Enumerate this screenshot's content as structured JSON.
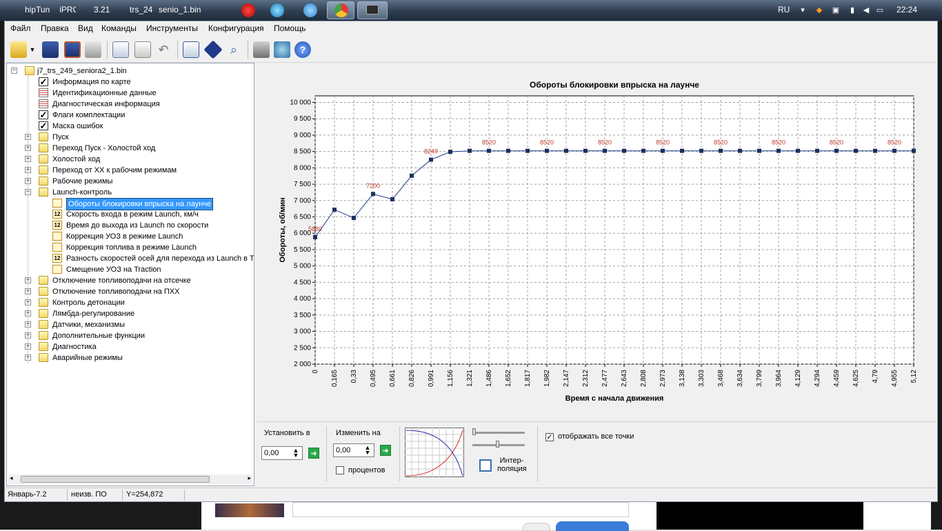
{
  "taskbar": {
    "buttons": [
      "hipTun",
      "iPRO",
      "3.21",
      "trs_24",
      "senio",
      "_1.bin"
    ],
    "lang": "RU",
    "clock": "22:24"
  },
  "menu": [
    "Файл",
    "Правка",
    "Вид",
    "Команды",
    "Инструменты",
    "Конфигурация",
    "Помощь"
  ],
  "toolbar": {
    "icons": [
      "open-icon",
      "save-icon",
      "save-as-icon",
      "print-icon",
      "copy-icon",
      "paste-icon",
      "undo-icon",
      "compare-icon",
      "info-icon",
      "search-icon",
      "settings-icon",
      "network-icon",
      "help-icon"
    ]
  },
  "tree": {
    "root": "j7_trs_249_seniora2_1.bin",
    "items": [
      {
        "label": "Информация по карте",
        "icon": "check"
      },
      {
        "label": "Идентификационные данные",
        "icon": "doc"
      },
      {
        "label": "Диагностическая информация",
        "icon": "doc"
      },
      {
        "label": "Флаги комплектации",
        "icon": "check"
      },
      {
        "label": "Маска ошибок",
        "icon": "check"
      },
      {
        "label": "Пуск",
        "icon": "folder"
      },
      {
        "label": "Переход Пуск - Холостой ход",
        "icon": "folder"
      },
      {
        "label": "Холостой ход",
        "icon": "folder"
      },
      {
        "label": "Переход от ХХ к рабочим режимам",
        "icon": "folder"
      },
      {
        "label": "Рабочие режимы",
        "icon": "folder"
      },
      {
        "label": "Launch-контроль",
        "icon": "folder-open"
      },
      {
        "label": "Обороты блокировки впрыска на лаунче",
        "icon": "chart",
        "child": true,
        "selected": true
      },
      {
        "label": "Скорость входа в режим Launch, км/ч",
        "icon": "num",
        "child": true
      },
      {
        "label": "Время до выхода из Launch по скорости",
        "icon": "num",
        "child": true
      },
      {
        "label": "Коррекция УОЗ в режиме Launch",
        "icon": "chart",
        "child": true
      },
      {
        "label": "Коррекция топлива в режиме Launch",
        "icon": "chart",
        "child": true
      },
      {
        "label": "Разность скоростей осей для перехода из Launch в T",
        "icon": "num",
        "child": true
      },
      {
        "label": "Смещение УОЗ на Traction",
        "icon": "chart",
        "child": true
      },
      {
        "label": "Отключение топливоподачи на отсечке",
        "icon": "folder"
      },
      {
        "label": "Отключение топливоподачи на ПХХ",
        "icon": "folder"
      },
      {
        "label": "Контроль детонации",
        "icon": "folder"
      },
      {
        "label": "Лямбда-регулирование",
        "icon": "folder"
      },
      {
        "label": "Датчики, механизмы",
        "icon": "folder"
      },
      {
        "label": "Дополнительные функции",
        "icon": "folder"
      },
      {
        "label": "Диагностика",
        "icon": "folder"
      },
      {
        "label": "Аварийные режимы",
        "icon": "folder"
      }
    ]
  },
  "chart_data": {
    "type": "line",
    "title": "Обороты блокировки впрыска на лаунче",
    "xlabel": "Время с начала движения",
    "ylabel": "Обороты, об/мин",
    "ylim": [
      2000,
      10200
    ],
    "yticks": [
      "2 000",
      "2 500",
      "3 000",
      "3 500",
      "4 000",
      "4 500",
      "5 000",
      "5 500",
      "6 000",
      "6 500",
      "7 000",
      "7 500",
      "8 000",
      "8 500",
      "9 000",
      "9 500",
      "10 000"
    ],
    "x": [
      "0",
      "0,165",
      "0,33",
      "0,495",
      "0,661",
      "0,826",
      "0,991",
      "1,156",
      "1,321",
      "1,486",
      "1,652",
      "1,817",
      "1,982",
      "2,147",
      "2,312",
      "2,477",
      "2,643",
      "2,808",
      "2,973",
      "3,138",
      "3,303",
      "3,468",
      "3,634",
      "3,799",
      "3,964",
      "4,129",
      "4,294",
      "4,459",
      "4,625",
      "4,79",
      "4,955",
      "5,12"
    ],
    "values": [
      5880,
      6720,
      6470,
      7200,
      7040,
      7760,
      8249,
      8490,
      8520,
      8520,
      8520,
      8520,
      8520,
      8520,
      8520,
      8520,
      8520,
      8520,
      8520,
      8520,
      8520,
      8520,
      8520,
      8520,
      8520,
      8520,
      8520,
      8520,
      8520,
      8520,
      8520,
      8520
    ],
    "data_labels": [
      {
        "index": 0,
        "text": "5880"
      },
      {
        "index": 3,
        "text": "7200"
      },
      {
        "index": 6,
        "text": "8249"
      },
      {
        "index": 9,
        "text": "8520"
      },
      {
        "index": 12,
        "text": "8520"
      },
      {
        "index": 15,
        "text": "8520"
      },
      {
        "index": 18,
        "text": "8520"
      },
      {
        "index": 21,
        "text": "8520"
      },
      {
        "index": 24,
        "text": "8520"
      },
      {
        "index": 27,
        "text": "8520"
      },
      {
        "index": 30,
        "text": "8520"
      }
    ],
    "grid": true,
    "colors": {
      "line": "#1f3a8a",
      "marker": "#1c2f5e",
      "label": "#c0392b"
    }
  },
  "controls": {
    "set_label": "Установить в",
    "set_value": "0,00",
    "change_label": "Изменить на",
    "change_value": "0,00",
    "percent_label": "процентов",
    "interp_line1": "Интер-",
    "interp_line2": "поляция",
    "show_all_label": "отображать все точки",
    "show_all_checked": true
  },
  "status": {
    "cell1": "Январь-7.2",
    "cell2": "неизв. ПО",
    "cell3": "Y=254,872"
  }
}
